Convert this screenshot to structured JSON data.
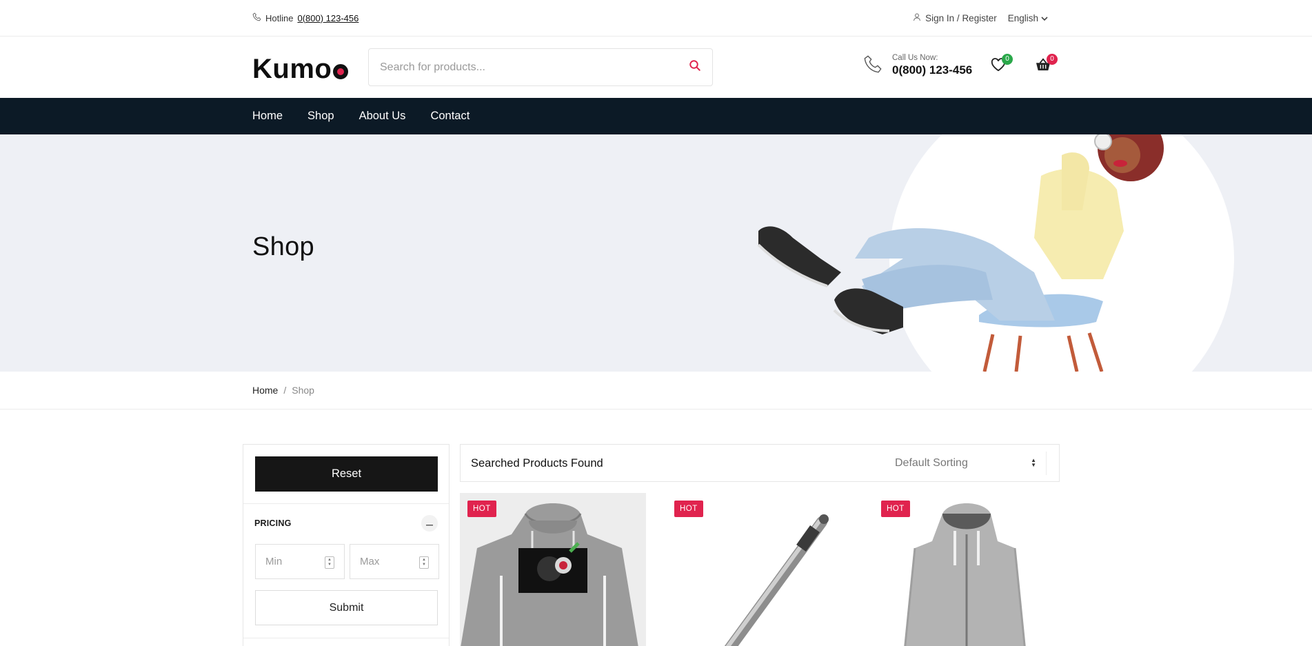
{
  "topbar": {
    "hotline_label": "Hotline",
    "hotline_number": "0(800) 123-456",
    "signin_label": "Sign In / Register",
    "language": "English"
  },
  "header": {
    "logo_text": "Kumo",
    "search_placeholder": "Search for products...",
    "call_label": "Call Us Now:",
    "call_number": "0(800) 123-456",
    "wishlist_count": "0",
    "cart_count": "0"
  },
  "nav": {
    "items": [
      {
        "label": "Home"
      },
      {
        "label": "Shop"
      },
      {
        "label": "About Us"
      },
      {
        "label": "Contact"
      }
    ]
  },
  "hero": {
    "title": "Shop"
  },
  "breadcrumb": {
    "home": "Home",
    "separator": "/",
    "current": "Shop"
  },
  "sidebar": {
    "reset_label": "Reset",
    "pricing_title": "PRICING",
    "min_placeholder": "Min",
    "max_placeholder": "Max",
    "submit_label": "Submit"
  },
  "results": {
    "found_label": "Searched Products Found",
    "sort_value": "Default Sorting"
  },
  "products": [
    {
      "badge": "HOT",
      "icon": "hoodie-monkey-image"
    },
    {
      "badge": "HOT",
      "icon": "pen-image"
    },
    {
      "badge": "HOT",
      "icon": "zip-hoodie-image"
    }
  ],
  "colors": {
    "accent": "#e0234e",
    "nav_bg": "#0c1a26",
    "hero_bg": "#eef0f5",
    "wishlist_badge": "#2aa84a"
  }
}
